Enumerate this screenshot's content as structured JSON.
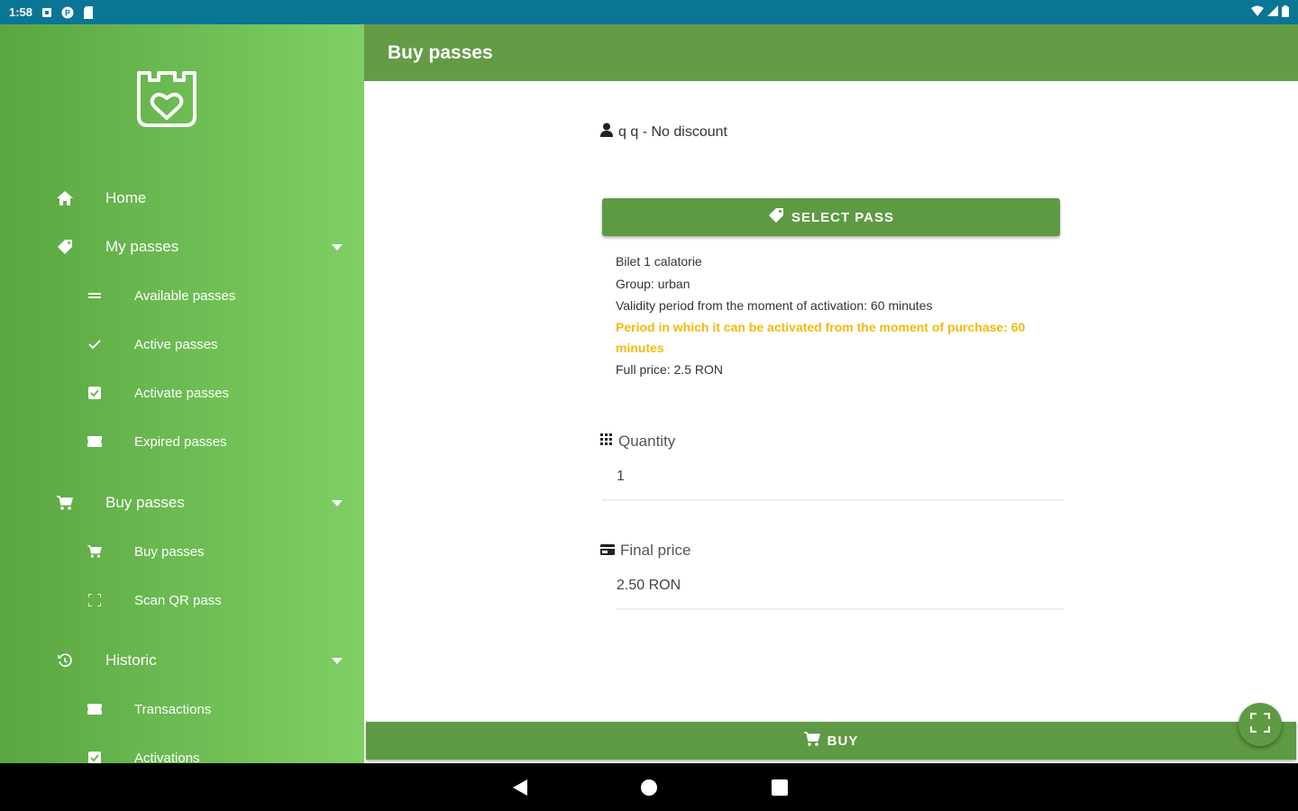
{
  "status_bar": {
    "time": "1:58"
  },
  "drawer": {
    "items": [
      {
        "label": "Home",
        "icon": "home-icon"
      },
      {
        "label": "My passes",
        "icon": "tag-icon"
      },
      {
        "label": "Available passes",
        "icon": "list-icon"
      },
      {
        "label": "Active passes",
        "icon": "check-icon"
      },
      {
        "label": "Activate passes",
        "icon": "checkbox-icon"
      },
      {
        "label": "Expired passes",
        "icon": "ticket-icon"
      },
      {
        "label": "Buy passes",
        "icon": "cart-icon"
      },
      {
        "label": "Buy passes",
        "icon": "cart-icon"
      },
      {
        "label": "Scan QR pass",
        "icon": "scan-icon"
      },
      {
        "label": "Historic",
        "icon": "history-icon"
      },
      {
        "label": "Transactions",
        "icon": "transactions-icon"
      },
      {
        "label": "Activations",
        "icon": "checkbox-icon"
      }
    ]
  },
  "appbar": {
    "title": "Buy passes"
  },
  "main": {
    "user_line": "q q - No discount",
    "select_pass_label": "SELECT PASS",
    "pass": {
      "name": "Bilet 1 calatorie",
      "group": "Group: urban",
      "validity": "Validity period from the moment of activation: 60 minutes",
      "activation_period": "Period in which it can be activated from the moment of purchase: 60 minutes",
      "full_price": "Full price: 2.5 RON"
    },
    "quantity_label": "Quantity",
    "quantity_value": "1",
    "final_price_label": "Final price",
    "final_price_value": "2.50 RON",
    "buy_label": "BUY"
  },
  "colors": {
    "status_bar": "#0b7596",
    "primary": "#649c45",
    "warning": "#f5b90c"
  }
}
